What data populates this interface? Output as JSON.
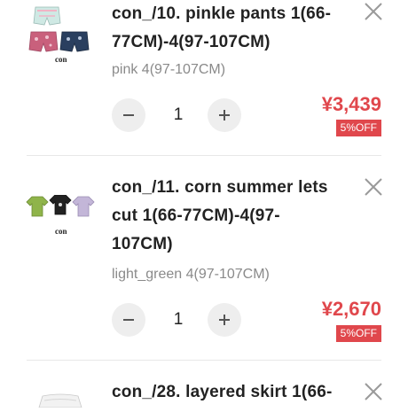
{
  "items": [
    {
      "name": "con_/10. pinkle pants 1(66-77CM)-4(97-107CM)",
      "title_line1": "con_/10. pinkle pants 1(66-",
      "title_line2": "77CM)-4(97-107CM)",
      "variant": "pink 4(97-107CM)",
      "quantity": "1",
      "price": "¥3,439",
      "discount": "5%OFF",
      "thumbnail_brand": "con"
    },
    {
      "name": "con_/11. corn summer lets cut 1(66-77CM)-4(97-107CM)",
      "title_line1": "con_/11. corn summer lets",
      "title_line2": "cut 1(66-77CM)-4(97-",
      "title_line3": "107CM)",
      "variant": "light_green 4(97-107CM)",
      "quantity": "1",
      "price": "¥2,670",
      "discount": "5%OFF",
      "thumbnail_brand": "con"
    },
    {
      "name": "con_/28. layered skirt 1(66-",
      "title_line1": "con_/28. layered skirt 1(66-"
    }
  ],
  "icons": {
    "remove": "close-icon",
    "decrement": "minus-icon",
    "increment": "plus-icon"
  },
  "colors": {
    "price": "#e0474c",
    "badge_bg": "#e0474c",
    "stepper_bg": "#eeeeee",
    "variant_text": "#8a8a8a"
  }
}
